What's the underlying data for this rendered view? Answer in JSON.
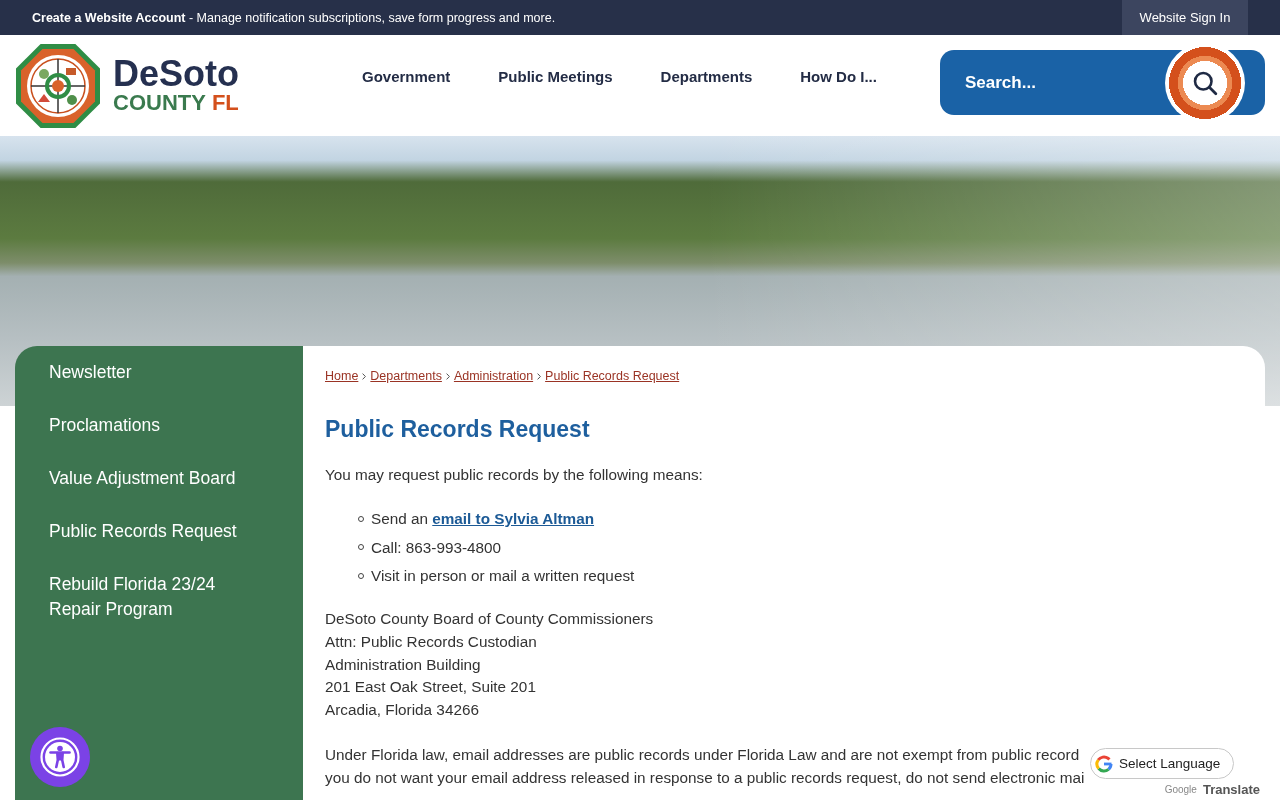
{
  "top_bar": {
    "account_link": "**Create a Website Account** - Manage notification subscriptions, save form progress and more.",
    "sign_in": "Website Sign In"
  },
  "header": {
    "logo": {
      "name": "DeSoto",
      "county": "COUNTY",
      "state": "FL"
    },
    "nav": [
      "Government",
      "Public Meetings",
      "Departments",
      "How Do I..."
    ],
    "search": {
      "placeholder": "Search..."
    }
  },
  "sidebar": {
    "items": [
      "Newsletter",
      "Proclamations",
      "Value Adjustment Board",
      "Public Records Request",
      "Rebuild Florida 23/24 Repair Program"
    ]
  },
  "breadcrumb": [
    "Home",
    "Departments",
    "Administration",
    "Public Records Request"
  ],
  "page": {
    "title": "Public Records Request",
    "intro": "You may request public records by the following means:",
    "means": [
      {
        "text": "Send an",
        "link": "email to Sylvia Altman"
      },
      {
        "text": "Call: 863-993-4800"
      },
      {
        "text": "Visit in person or mail a written request"
      }
    ],
    "address": [
      "DeSoto County Board of County Commissioners",
      "Attn: Public Records Custodian",
      "Administration Building",
      "201 East Oak Street, Suite 201",
      "Arcadia, Florida 34266"
    ],
    "notice": [
      "Under Florida law, email addresses are public records under Florida Law and are not exempt from public record",
      "you do not want your email address released in response to a public records request, do not send electronic mai"
    ]
  },
  "translate": {
    "label": "Select Language",
    "provider": "Google",
    "action": "Translate"
  }
}
